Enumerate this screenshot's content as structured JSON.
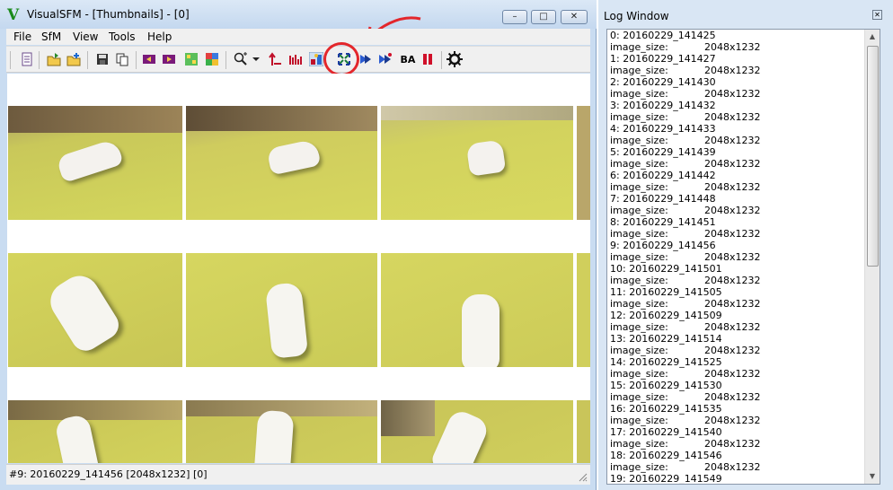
{
  "window": {
    "title": "VisualSFM - [Thumbnails] - [0]",
    "app_icon": "V",
    "controls": {
      "minimize": "–",
      "maximize": "□",
      "close": "✕"
    }
  },
  "menu": [
    "File",
    "SfM",
    "View",
    "Tools",
    "Help"
  ],
  "toolbar": {
    "icons": [
      "document-icon",
      "open-folder-icon",
      "add-images-icon",
      "save-icon",
      "copy-icon",
      "film-prev-icon",
      "film-next-icon",
      "match-icon",
      "palette-icon",
      "zoom-icon",
      "dropdown-icon",
      "arrow-up-icon",
      "grid-icon",
      "pair-icon",
      "reconstruct-icon",
      "forward-icon",
      "fast-forward-icon",
      "ba-icon",
      "pause-icon",
      "gear-icon"
    ],
    "ba_label": "BA",
    "highlight_color": "#e3262b"
  },
  "status": {
    "text": "#9: 20160229_141456 [2048x1232] [0]"
  },
  "log": {
    "title": "Log Window",
    "lines": [
      {
        "label": "0: 20160229_141425",
        "value": ""
      },
      {
        "label": "image_size:",
        "value": "2048x1232"
      },
      {
        "label": "1: 20160229_141427",
        "value": ""
      },
      {
        "label": "image_size:",
        "value": "2048x1232"
      },
      {
        "label": "2: 20160229_141430",
        "value": ""
      },
      {
        "label": "image_size:",
        "value": "2048x1232"
      },
      {
        "label": "3: 20160229_141432",
        "value": ""
      },
      {
        "label": "image_size:",
        "value": "2048x1232"
      },
      {
        "label": "4: 20160229_141433",
        "value": ""
      },
      {
        "label": "image_size:",
        "value": "2048x1232"
      },
      {
        "label": "5: 20160229_141439",
        "value": ""
      },
      {
        "label": "image_size:",
        "value": "2048x1232"
      },
      {
        "label": "6: 20160229_141442",
        "value": ""
      },
      {
        "label": "image_size:",
        "value": "2048x1232"
      },
      {
        "label": "7: 20160229_141448",
        "value": ""
      },
      {
        "label": "image_size:",
        "value": "2048x1232"
      },
      {
        "label": "8: 20160229_141451",
        "value": ""
      },
      {
        "label": "image_size:",
        "value": "2048x1232"
      },
      {
        "label": "9: 20160229_141456",
        "value": ""
      },
      {
        "label": "image_size:",
        "value": "2048x1232"
      },
      {
        "label": "10: 20160229_141501",
        "value": ""
      },
      {
        "label": "image_size:",
        "value": "2048x1232"
      },
      {
        "label": "11: 20160229_141505",
        "value": ""
      },
      {
        "label": "image_size:",
        "value": "2048x1232"
      },
      {
        "label": "12: 20160229_141509",
        "value": ""
      },
      {
        "label": "image_size:",
        "value": "2048x1232"
      },
      {
        "label": "13: 20160229_141514",
        "value": ""
      },
      {
        "label": "image_size:",
        "value": "2048x1232"
      },
      {
        "label": "14: 20160229_141525",
        "value": ""
      },
      {
        "label": "image_size:",
        "value": "2048x1232"
      },
      {
        "label": "15: 20160229_141530",
        "value": ""
      },
      {
        "label": "image_size:",
        "value": "2048x1232"
      },
      {
        "label": "16: 20160229_141535",
        "value": ""
      },
      {
        "label": "image_size:",
        "value": "2048x1232"
      },
      {
        "label": "17: 20160229_141540",
        "value": ""
      },
      {
        "label": "image_size:",
        "value": "2048x1232"
      },
      {
        "label": "18: 20160229_141546",
        "value": ""
      },
      {
        "label": "image_size:",
        "value": "2048x1232"
      },
      {
        "label": "19: 20160229_141549",
        "value": ""
      }
    ]
  }
}
